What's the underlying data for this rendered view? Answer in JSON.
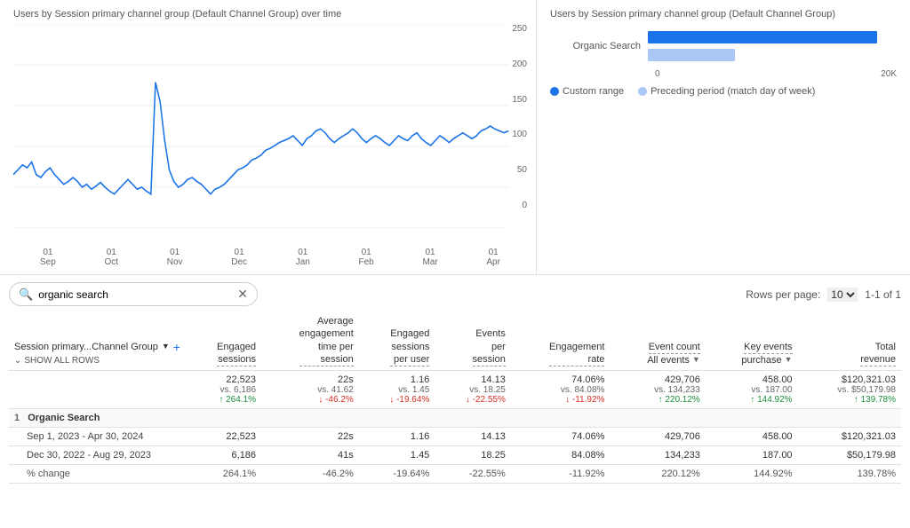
{
  "leftChart": {
    "title": "Users by Session primary channel group (Default Channel Group) over time",
    "yLabels": [
      "250",
      "200",
      "150",
      "100",
      "50",
      "0"
    ],
    "xLabels": [
      {
        "line1": "01",
        "line2": "Sep"
      },
      {
        "line1": "01",
        "line2": "Oct"
      },
      {
        "line1": "01",
        "line2": "Nov"
      },
      {
        "line1": "01",
        "line2": "Dec"
      },
      {
        "line1": "01",
        "line2": "Jan"
      },
      {
        "line1": "01",
        "line2": "Feb"
      },
      {
        "line1": "01",
        "line2": "Mar"
      },
      {
        "line1": "01",
        "line2": "Apr"
      }
    ]
  },
  "rightChart": {
    "title": "Users by Session primary channel group (Default Channel Group)",
    "label": "Organic Search",
    "bar1Width": "92%",
    "bar2Width": "35%",
    "xLabels": [
      "0",
      "20K"
    ],
    "legend": {
      "item1": "Custom range",
      "item2": "Preceding period (match day of week)"
    }
  },
  "search": {
    "placeholder": "organic search",
    "value": "organic search"
  },
  "pagination": {
    "rowsLabel": "Rows per page:",
    "rowsValue": "10",
    "rangeLabel": "1-1 of 1"
  },
  "table": {
    "dimHeader": "Session primary...Channel Group",
    "showAllRows": "SHOW ALL ROWS",
    "columns": [
      {
        "label": "Engaged\nsessions"
      },
      {
        "label": "Average\nengagement\ntime per\nsession"
      },
      {
        "label": "Engaged\nsessions\nper user"
      },
      {
        "label": "Events\nper\nsession"
      },
      {
        "label": "Engagement\nrate"
      },
      {
        "label": "Event count\nAll events"
      },
      {
        "label": "Key events\npurchase"
      },
      {
        "label": "Total\nrevenue"
      }
    ],
    "summary": {
      "row1": {
        "engagedSessions": "22,523",
        "avgEngTime": "22s",
        "engSessPerUser": "1.16",
        "eventsPerSess": "14.13",
        "engRate": "74.06%",
        "eventCount": "429,706",
        "keyEvents": "458.00",
        "totalRevenue": "$120,321.03"
      },
      "row2": {
        "engagedSessions": "vs. 6,186",
        "avgEngTime": "vs. 41.62",
        "engSessPerUser": "vs. 1.45",
        "eventsPerSess": "vs. 18.25",
        "engRate": "vs. 84.08%",
        "eventCount": "vs. 134,233",
        "keyEvents": "vs. 187.00",
        "totalRevenue": "vs. $50,179.98"
      },
      "row3": {
        "engagedSessions": {
          "val": "264.1%",
          "dir": "up"
        },
        "avgEngTime": {
          "val": "-46.2%",
          "dir": "down"
        },
        "engSessPerUser": {
          "val": "-19.64%",
          "dir": "down"
        },
        "eventsPerSess": {
          "val": "-22.55%",
          "dir": "down"
        },
        "engRate": {
          "val": "-11.92%",
          "dir": "down"
        },
        "eventCount": {
          "val": "220.12%",
          "dir": "up"
        },
        "keyEvents": {
          "val": "144.92%",
          "dir": "up"
        },
        "totalRevenue": {
          "val": "139.78%",
          "dir": "up"
        }
      }
    },
    "dataRows": [
      {
        "index": "1",
        "dimension": "Organic Search",
        "subRows": [
          {
            "label": "Sep 1, 2023 - Apr 30, 2024",
            "engagedSessions": "22,523",
            "avgEngTime": "22s",
            "engSessPerUser": "1.16",
            "eventsPerSess": "14.13",
            "engRate": "74.06%",
            "eventCount": "429,706",
            "keyEvents": "458.00",
            "totalRevenue": "$120,321.03"
          },
          {
            "label": "Dec 30, 2022 - Aug 29, 2023",
            "engagedSessions": "6,186",
            "avgEngTime": "41s",
            "engSessPerUser": "1.45",
            "eventsPerSess": "18.25",
            "engRate": "84.08%",
            "eventCount": "134,233",
            "keyEvents": "187.00",
            "totalRevenue": "$50,179.98"
          },
          {
            "label": "% change",
            "engagedSessions": "264.1%",
            "avgEngTime": "-46.2%",
            "engSessPerUser": "-19.64%",
            "eventsPerSess": "-22.55%",
            "engRate": "-11.92%",
            "eventCount": "220.12%",
            "keyEvents": "144.92%",
            "totalRevenue": "139.78%"
          }
        ]
      }
    ]
  }
}
